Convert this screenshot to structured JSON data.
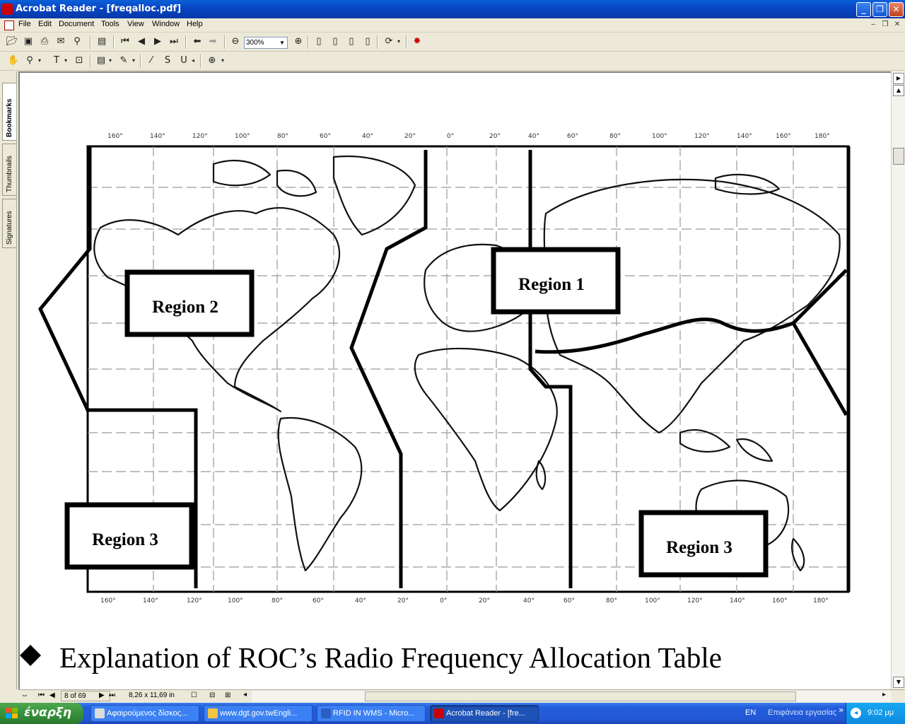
{
  "window": {
    "title": "Acrobat Reader - [freqalloc.pdf]",
    "minimize": "_",
    "restore": "❐",
    "close": "✕"
  },
  "menu": {
    "items": [
      "File",
      "Edit",
      "Document",
      "Tools",
      "View",
      "Window",
      "Help"
    ]
  },
  "toolbar": {
    "zoom_value": "300%"
  },
  "sidetabs": [
    "Bookmarks",
    "Thumbnails",
    "Signatures"
  ],
  "document": {
    "map_labels": {
      "region1": "Region 1",
      "region2": "Region 2",
      "region3_left": "Region 3",
      "region3_right": "Region 3"
    },
    "caption": "Explanation of ROC’s Radio Frequency Allocation Table"
  },
  "statusbar": {
    "page_indicator": "8 of 69",
    "page_size": "8,26 x 11,69 in"
  },
  "taskbar": {
    "start_label": "έναρξη",
    "tasks": [
      {
        "label": "Αφαιρούμενος δίσκος...",
        "active": false,
        "icon_color": "#dcdcdc"
      },
      {
        "label": "www.dgt.gov.twEngli...",
        "active": false,
        "icon_color": "#f4c542"
      },
      {
        "label": "RFID IN WMS - Micro...",
        "active": false,
        "icon_color": "#2b5fbf"
      },
      {
        "label": "Acrobat Reader - [fre...",
        "active": true,
        "icon_color": "#c80000"
      }
    ],
    "language": "EN",
    "desktop_label": "Επιφάνεια εργασίας",
    "clock": "9:02 μμ"
  }
}
